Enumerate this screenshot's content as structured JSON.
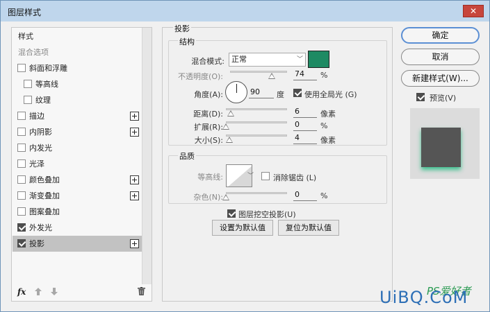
{
  "window": {
    "title": "图层样式",
    "close_label": "✕"
  },
  "left_panel": {
    "header": "样式",
    "blend_options": "混合选项",
    "items": [
      {
        "label": "斜面和浮雕",
        "checked": false,
        "plus": false
      },
      {
        "label": "等高线",
        "checked": false,
        "plus": false
      },
      {
        "label": "纹理",
        "checked": false,
        "plus": false
      },
      {
        "label": "描边",
        "checked": false,
        "plus": true
      },
      {
        "label": "内阴影",
        "checked": false,
        "plus": true
      },
      {
        "label": "内发光",
        "checked": false,
        "plus": false
      },
      {
        "label": "光泽",
        "checked": false,
        "plus": false
      },
      {
        "label": "颜色叠加",
        "checked": false,
        "plus": true
      },
      {
        "label": "渐变叠加",
        "checked": false,
        "plus": true
      },
      {
        "label": "图案叠加",
        "checked": false,
        "plus": false
      },
      {
        "label": "外发光",
        "checked": true,
        "plus": false
      },
      {
        "label": "投影",
        "checked": true,
        "plus": true,
        "selected": true
      }
    ],
    "fx_label": "fx"
  },
  "drop_shadow": {
    "section": "投影",
    "structure": {
      "title": "结构",
      "blend_mode_label": "混合模式:",
      "blend_mode_value": "正常",
      "shadow_color": "#1e8a63",
      "opacity_label": "不透明度(O):",
      "opacity_value": "74",
      "opacity_unit": "%",
      "angle_label": "角度(A):",
      "angle_value": "90",
      "angle_unit": "度",
      "global_light_label": "使用全局光 (G)",
      "global_light_checked": true,
      "distance_label": "距离(D):",
      "distance_value": "6",
      "distance_unit": "像素",
      "spread_label": "扩展(R):",
      "spread_value": "0",
      "spread_unit": "%",
      "size_label": "大小(S):",
      "size_value": "4",
      "size_unit": "像素"
    },
    "quality": {
      "title": "品质",
      "contour_label": "等高线:",
      "antialias_label": "消除锯齿 (L)",
      "antialias_checked": false,
      "noise_label": "杂色(N):",
      "noise_value": "0",
      "noise_unit": "%"
    },
    "knockout_label": "图层挖空投影(U)",
    "knockout_checked": true,
    "make_default": "设置为默认值",
    "reset_default": "复位为默认值"
  },
  "right_panel": {
    "ok": "确定",
    "cancel": "取消",
    "new_style": "新建样式(W)...",
    "preview_label": "预览(V)",
    "preview_checked": true
  },
  "watermark": {
    "text": "UiBQ.CoM",
    "brand": "PS爱好者"
  }
}
